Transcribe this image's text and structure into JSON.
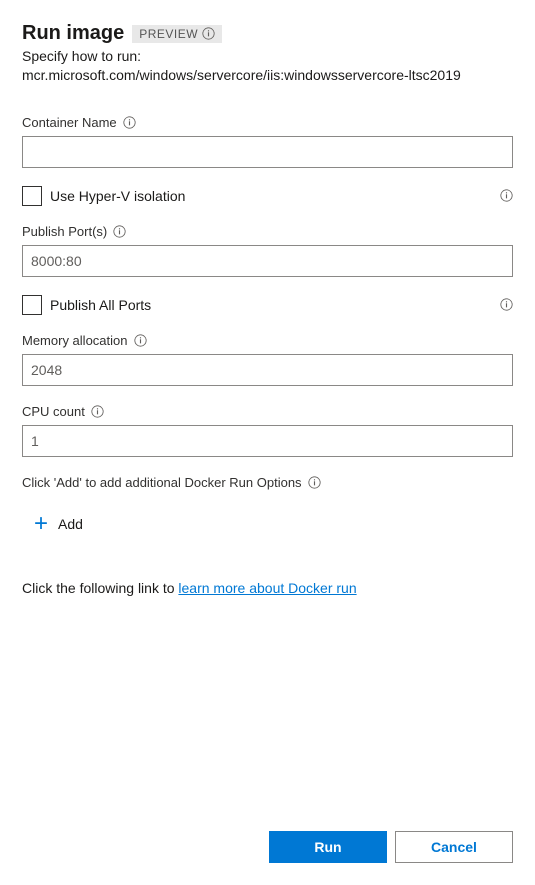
{
  "header": {
    "title": "Run image",
    "preview_label": "PREVIEW",
    "subtitle_prefix": "Specify how to run:",
    "image_path": "mcr.microsoft.com/windows/servercore/iis:windowsservercore-ltsc2019"
  },
  "fields": {
    "container_name": {
      "label": "Container Name",
      "value": ""
    },
    "hyperv": {
      "label": "Use Hyper-V isolation",
      "checked": false
    },
    "publish_ports": {
      "label": "Publish Port(s)",
      "value": "8000:80"
    },
    "publish_all": {
      "label": "Publish All Ports",
      "checked": false
    },
    "memory": {
      "label": "Memory allocation",
      "value": "2048"
    },
    "cpu": {
      "label": "CPU count",
      "value": "1"
    },
    "additional": {
      "hint": "Click 'Add' to add additional Docker Run Options",
      "add_label": "Add"
    }
  },
  "learn_more": {
    "prefix": "Click the following link to ",
    "link_text": "learn more about Docker run"
  },
  "footer": {
    "run_label": "Run",
    "cancel_label": "Cancel"
  }
}
